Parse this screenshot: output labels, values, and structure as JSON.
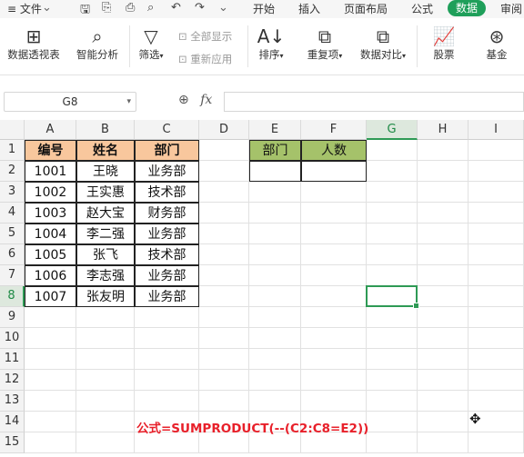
{
  "menubar": {
    "file_label": "≡ 文件",
    "tabs": [
      "开始",
      "插入",
      "页面布局",
      "公式",
      "数据",
      "审阅"
    ],
    "active_tab": "数据"
  },
  "ribbon": {
    "pivot_table": "数据透视表",
    "smart_analysis": "智能分析",
    "filter": "筛选",
    "show_all": "全部显示",
    "reapply": "重新应用",
    "sort": "排序",
    "duplicates": "重复项",
    "compare": "数据对比",
    "stocks": "股票",
    "funds": "基金"
  },
  "formula_bar": {
    "name_box": "G8",
    "fx": "fx",
    "content": ""
  },
  "columns": [
    "A",
    "B",
    "C",
    "D",
    "E",
    "F",
    "G",
    "H",
    "I"
  ],
  "selected_column": "G",
  "rows": [
    "1",
    "2",
    "3",
    "4",
    "5",
    "6",
    "7",
    "8",
    "9",
    "10",
    "11",
    "12",
    "13",
    "14",
    "15"
  ],
  "selected_row": "8",
  "table1": {
    "headers": [
      "编号",
      "姓名",
      "部门"
    ],
    "data": [
      [
        "1001",
        "王晓",
        "业务部"
      ],
      [
        "1002",
        "王实惠",
        "技术部"
      ],
      [
        "1003",
        "赵大宝",
        "财务部"
      ],
      [
        "1004",
        "李二强",
        "业务部"
      ],
      [
        "1005",
        "张飞",
        "技术部"
      ],
      [
        "1006",
        "李志强",
        "业务部"
      ],
      [
        "1007",
        "张友明",
        "业务部"
      ]
    ]
  },
  "table2": {
    "headers": [
      "部门",
      "人数"
    ]
  },
  "note": "公式=SUMPRODUCT(--(C2:C8=E2))",
  "colors": {
    "accent": "#1f9f5a",
    "header_orange": "#f8c79d",
    "header_green": "#a5c26a",
    "note_red": "#e8202a"
  }
}
